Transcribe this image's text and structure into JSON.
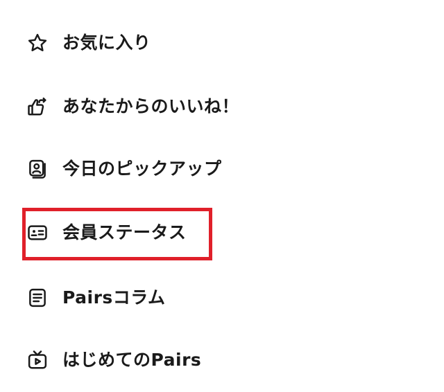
{
  "menu": {
    "items": [
      {
        "icon": "star-icon",
        "label": "お気に入り"
      },
      {
        "icon": "thumbs-up-share-icon",
        "label": "あなたからのいいね！"
      },
      {
        "icon": "profile-card-icon",
        "label": "今日のピックアップ"
      },
      {
        "icon": "member-card-icon",
        "label": "会員ステータス"
      },
      {
        "icon": "article-icon",
        "label": "Pairsコラム"
      },
      {
        "icon": "video-tv-icon",
        "label": "はじめてのPairs"
      }
    ]
  },
  "highlight": {
    "color": "#e0202a",
    "target": "会員ステータス"
  },
  "colors": {
    "text": "#1a1a1a",
    "background": "#ffffff"
  }
}
